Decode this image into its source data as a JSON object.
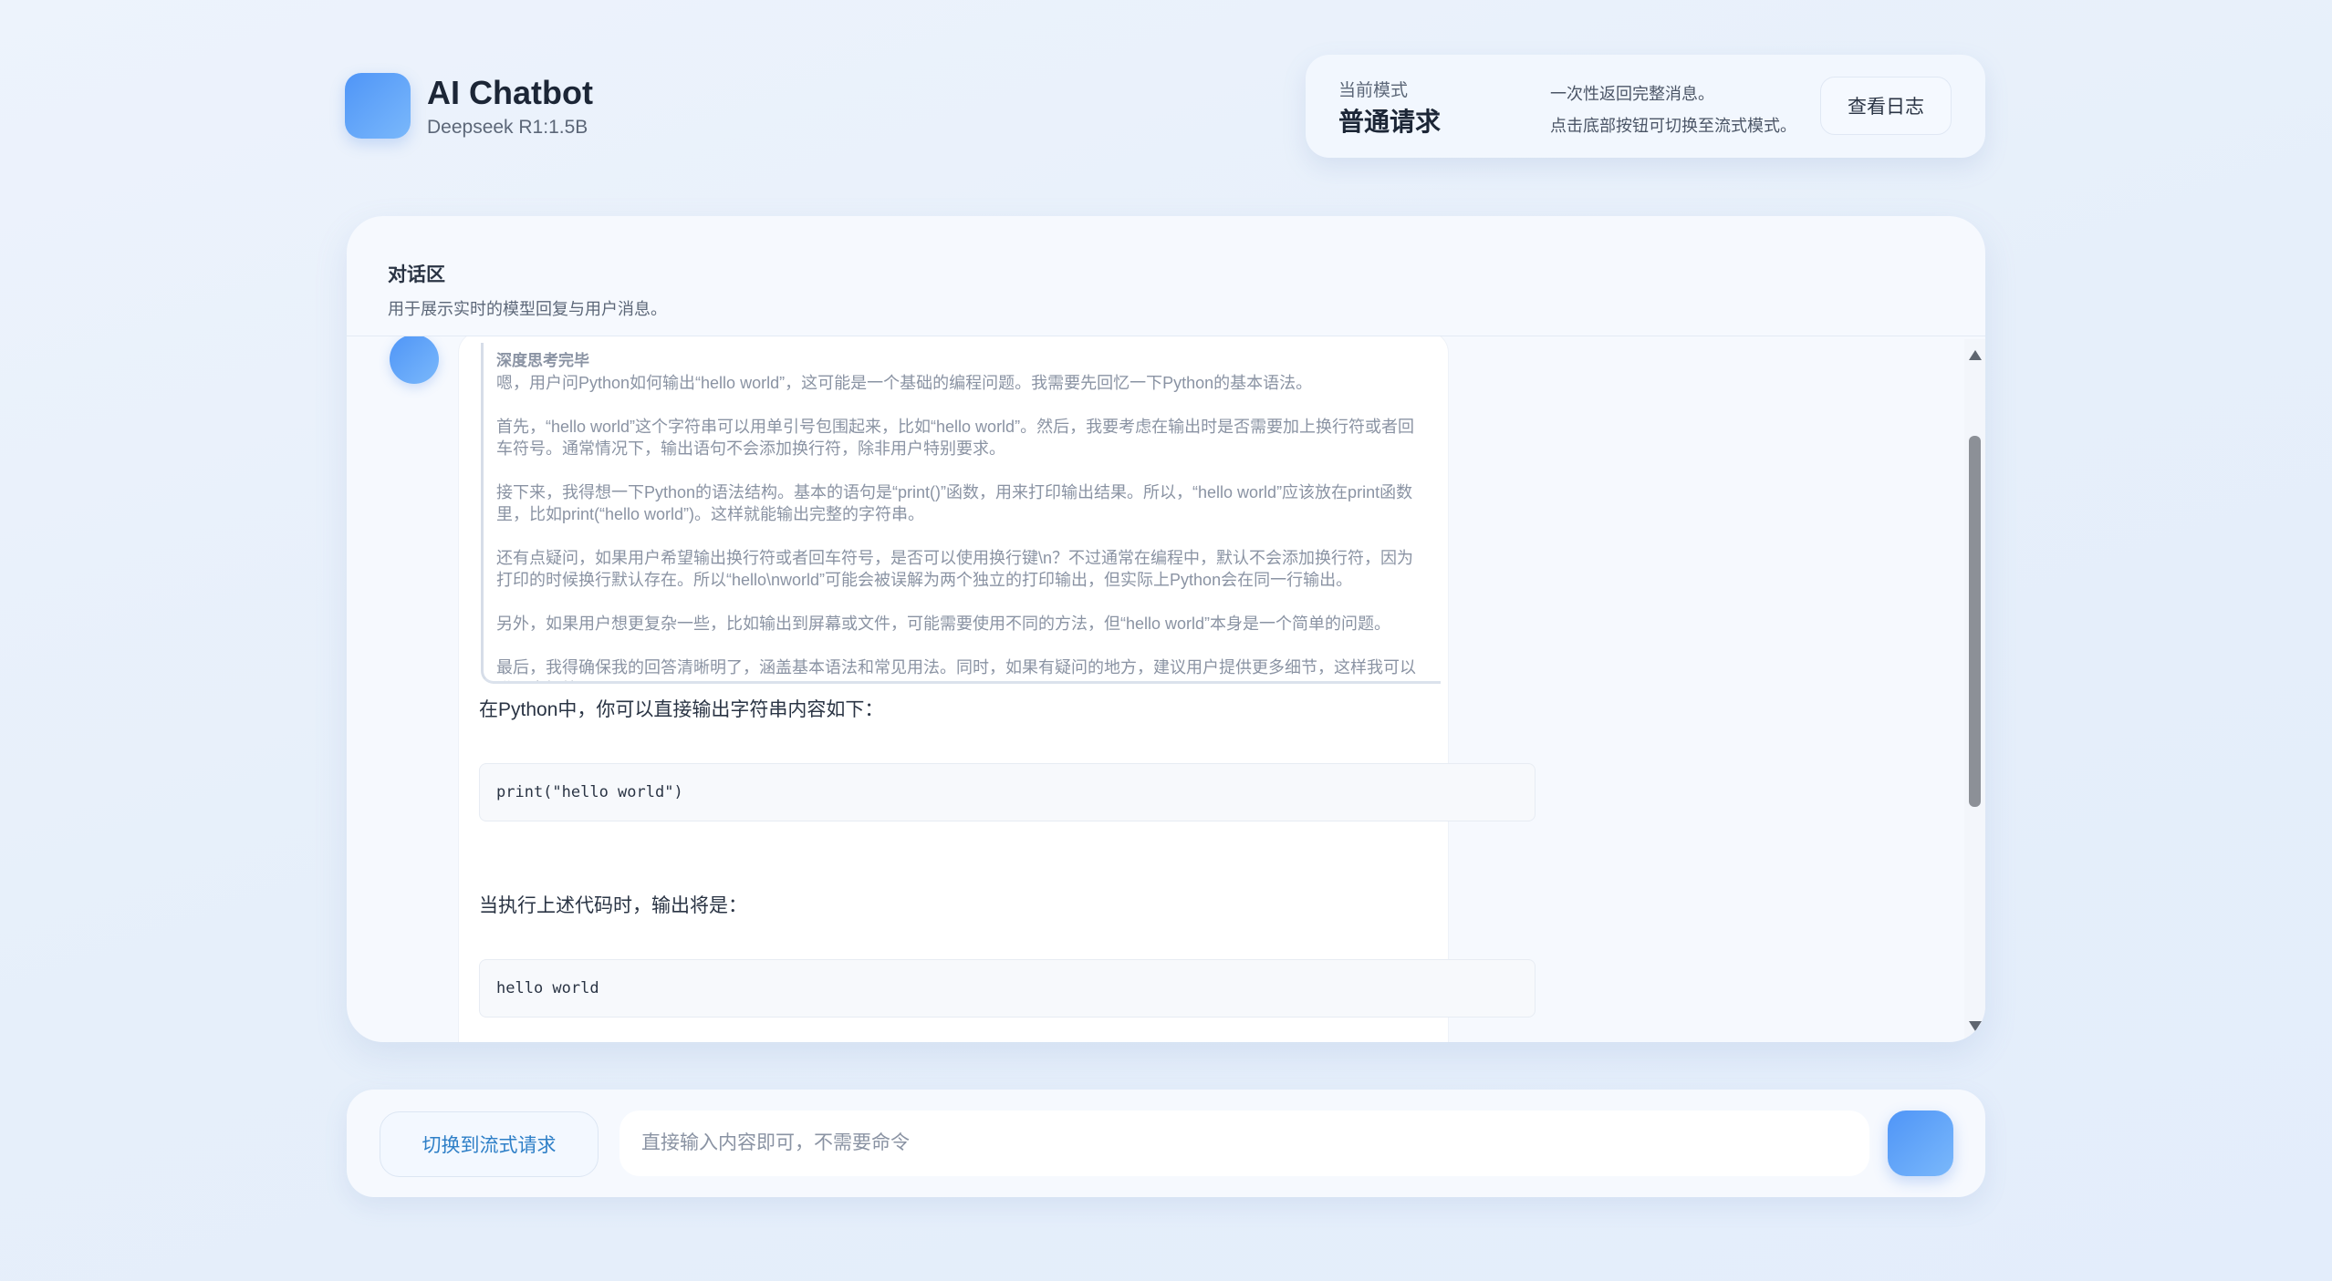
{
  "header": {
    "title": "AI Chatbot",
    "subtitle": "Deepseek R1:1.5B"
  },
  "mode": {
    "label": "当前模式",
    "value": "普通请求",
    "desc_line1": "一次性返回完整消息。",
    "desc_line2": "点击底部按钮可切换至流式模式。",
    "log_button": "查看日志"
  },
  "chat": {
    "title": "对话区",
    "subtitle": "用于展示实时的模型回复与用户消息。",
    "message": {
      "think_title": "深度思考完毕",
      "think_paragraphs": [
        "嗯，用户问Python如何输出“hello world”，这可能是一个基础的编程问题。我需要先回忆一下Python的基本语法。",
        "首先，“hello world”这个字符串可以用单引号包围起来，比如“hello world”。然后，我要考虑在输出时是否需要加上换行符或者回车符号。通常情况下，输出语句不会添加换行符，除非用户特别要求。",
        "接下来，我得想一下Python的语法结构。基本的语句是“print()”函数，用来打印输出结果。所以，“hello world”应该放在print函数里，比如print(“hello world”)。这样就能输出完整的字符串。",
        "还有点疑问，如果用户希望输出换行符或者回车符号，是否可以使用换行键\\n？不过通常在编程中，默认不会添加换行符，因为打印的时候换行默认存在。所以“hello\\nworld”可能会被误解为两个独立的打印输出，但实际上Python会在同一行输出。",
        "另外，如果用户想更复杂一些，比如输出到屏幕或文件，可能需要使用不同的方法，但“hello world”本身是一个简单的问题。",
        "最后，我得确保我的回答清晰明了，涵盖基本语法和常见用法。同时，如果有疑问的地方，建议用户提供更多细节，这样我可以进一步解答。"
      ],
      "answer_intro": "在Python中，你可以直接输出字符串内容如下：",
      "code_1": "print(\"hello world\")",
      "answer_output_label": "当执行上述代码时，输出将是：",
      "code_2": "hello world"
    }
  },
  "input": {
    "switch_button": "切换到流式请求",
    "placeholder": "直接输入内容即可，不需要命令"
  },
  "colors": {
    "accent": "#4f95f7",
    "switch_text": "#2e7fc7"
  }
}
